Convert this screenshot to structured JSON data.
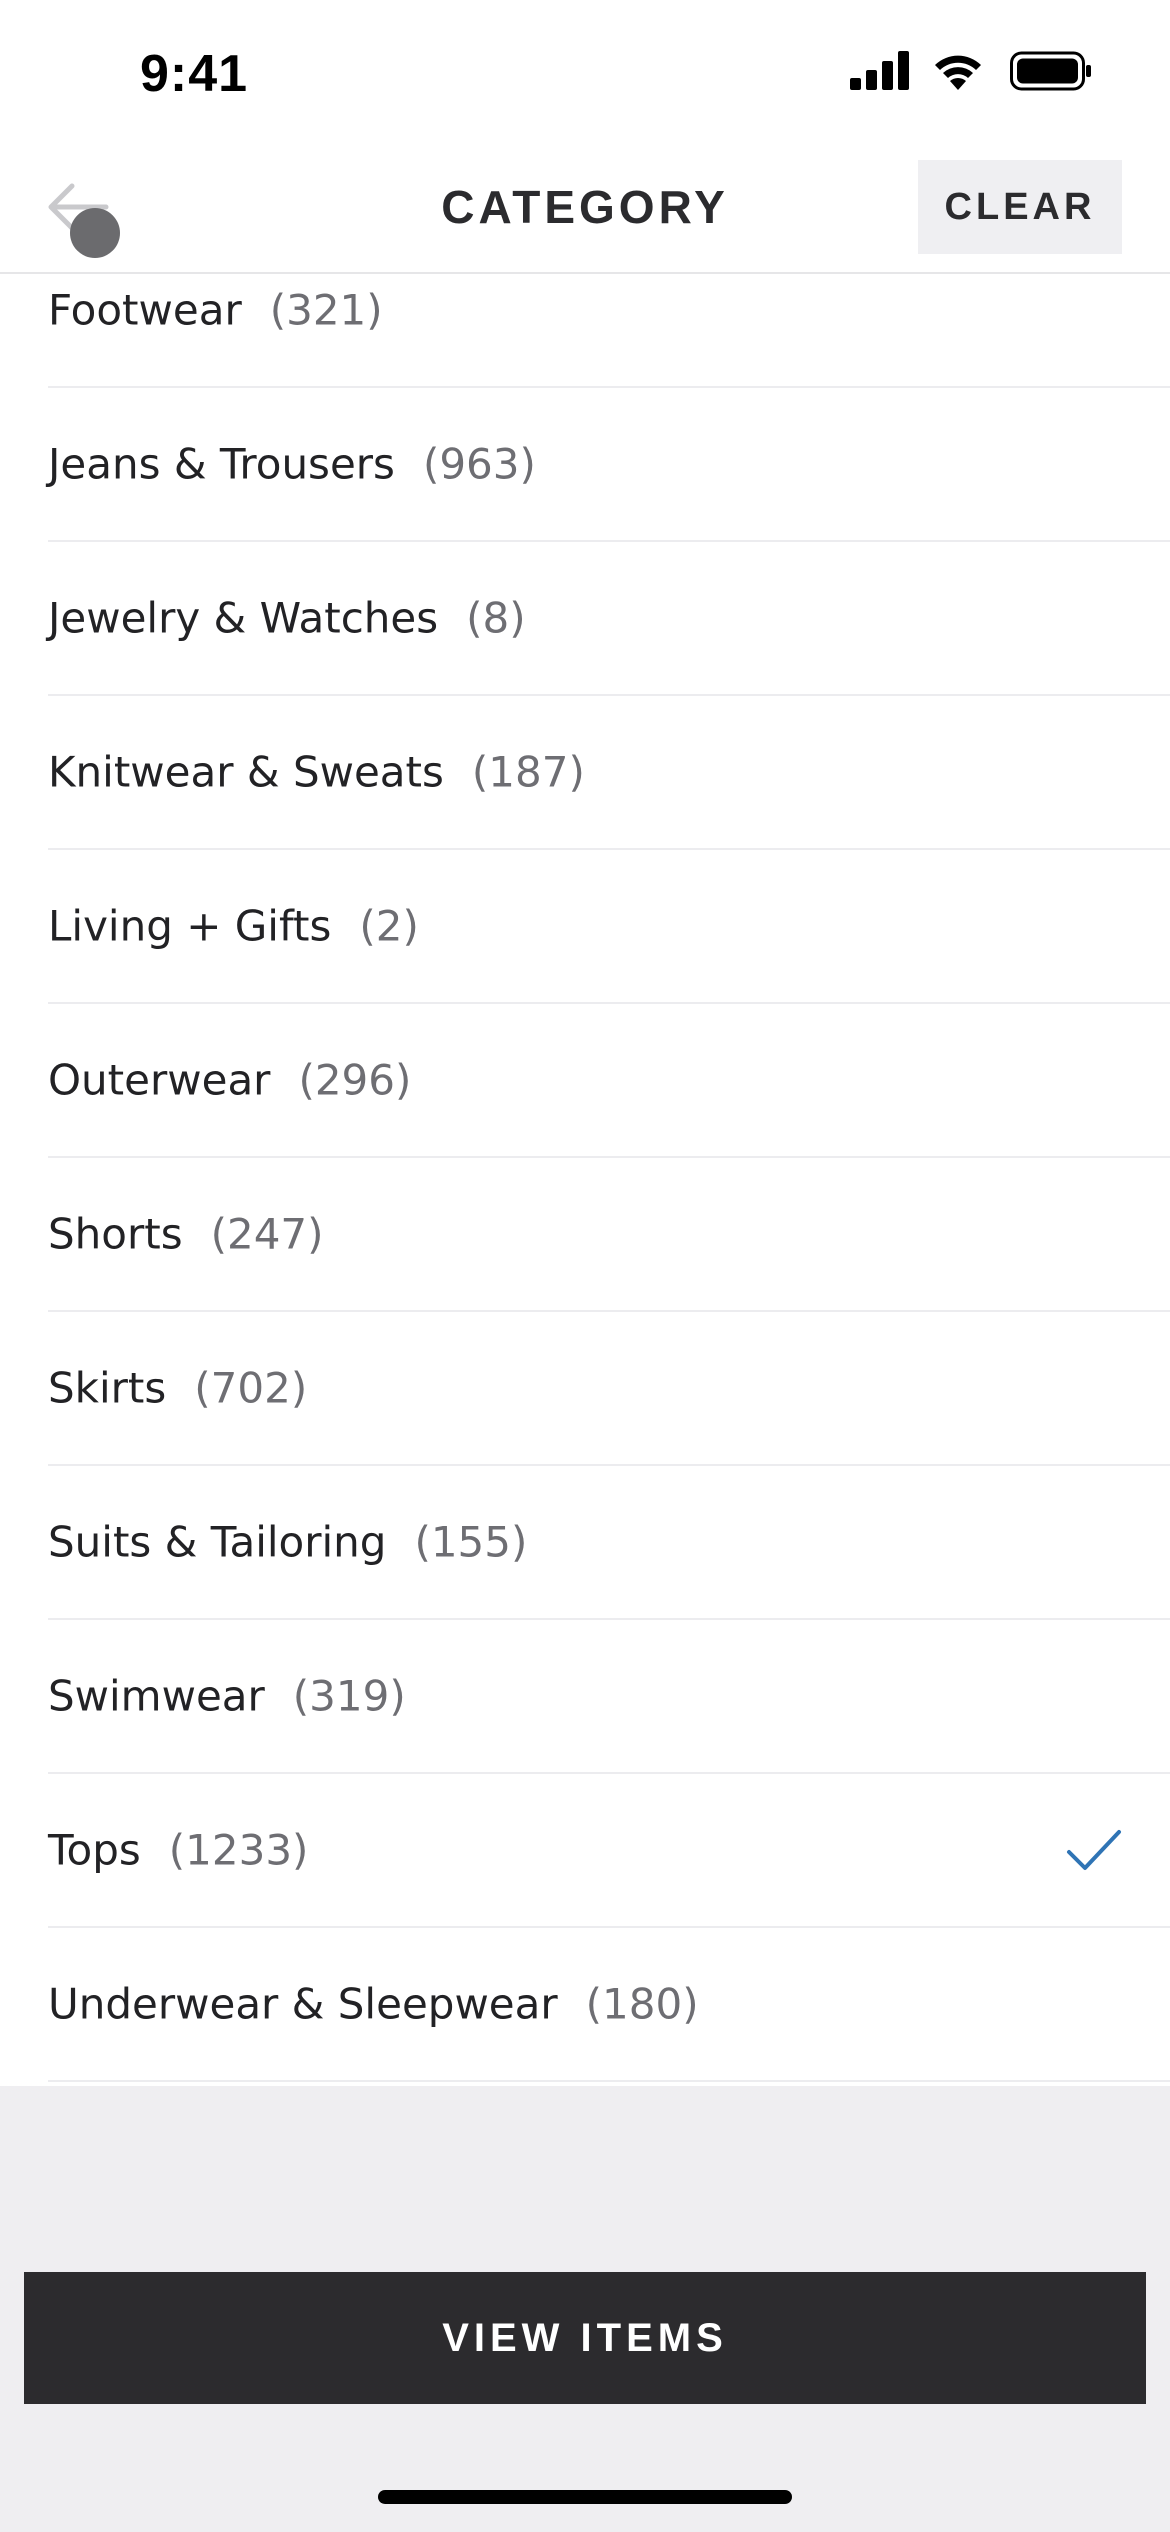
{
  "status_bar": {
    "time": "9:41",
    "icons": [
      "cellular-signal-icon",
      "wifi-icon",
      "battery-icon"
    ]
  },
  "nav": {
    "title": "CATEGORY",
    "clear_label": "CLEAR",
    "back_icon": "back-arrow-icon"
  },
  "categories": [
    {
      "name": "Footwear",
      "count": "(321)",
      "selected": false
    },
    {
      "name": "Jeans & Trousers",
      "count": "(963)",
      "selected": false
    },
    {
      "name": "Jewelry & Watches",
      "count": "(8)",
      "selected": false
    },
    {
      "name": "Knitwear & Sweats",
      "count": "(187)",
      "selected": false
    },
    {
      "name": "Living + Gifts",
      "count": "(2)",
      "selected": false
    },
    {
      "name": "Outerwear",
      "count": "(296)",
      "selected": false
    },
    {
      "name": "Shorts",
      "count": "(247)",
      "selected": false
    },
    {
      "name": "Skirts",
      "count": "(702)",
      "selected": false
    },
    {
      "name": "Suits & Tailoring",
      "count": "(155)",
      "selected": false
    },
    {
      "name": "Swimwear",
      "count": "(319)",
      "selected": false
    },
    {
      "name": "Tops",
      "count": "(1233)",
      "selected": true
    },
    {
      "name": "Underwear & Sleepwear",
      "count": "(180)",
      "selected": false
    }
  ],
  "footer": {
    "view_items_label": "VIEW ITEMS"
  },
  "colors": {
    "accent_check": "#2f74b5",
    "primary_button": "#2c2b2e",
    "background": "#efeef1"
  }
}
